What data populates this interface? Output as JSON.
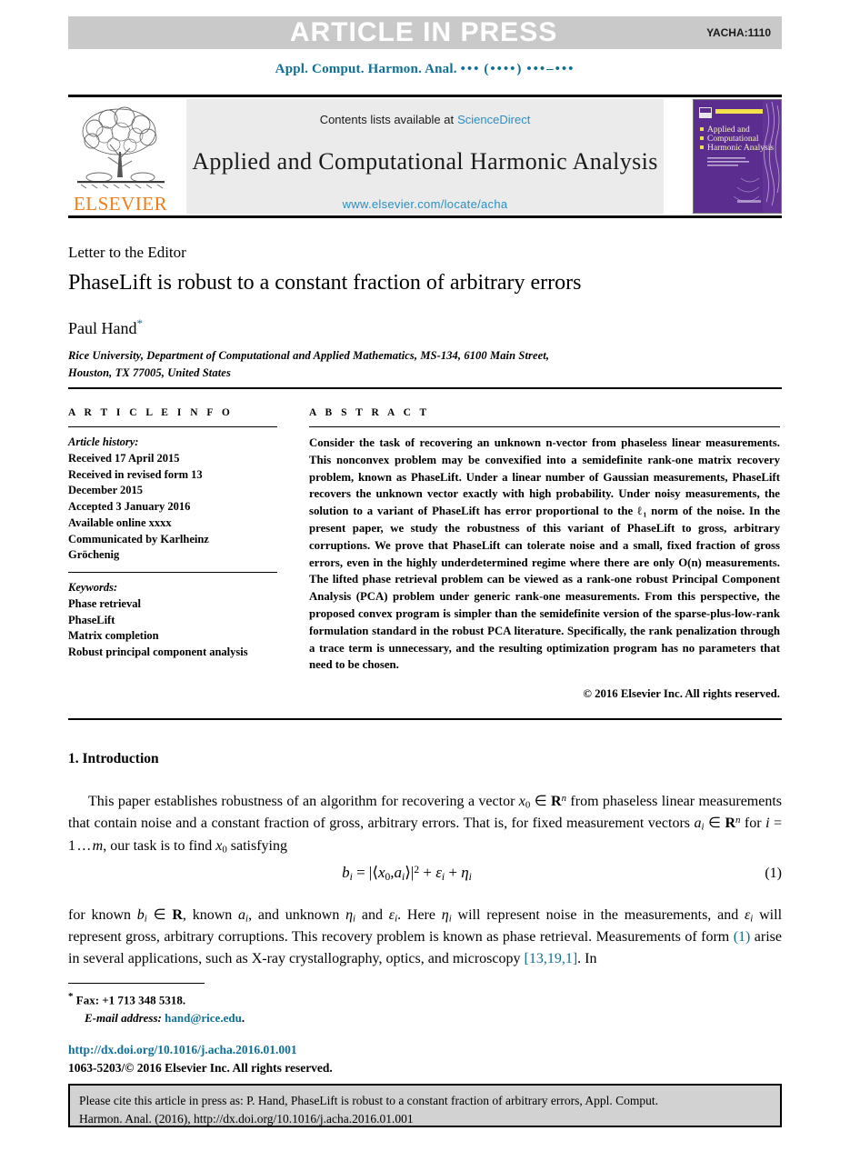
{
  "banner": {
    "title": "ARTICLE IN PRESS",
    "code": "YACHA:1110",
    "bg_color": "#c9c9c9"
  },
  "running_citation": {
    "journal_abbrev": "Appl. Comput. Harmon. Anal.",
    "volume_dots": "•••",
    "year_dots": "(••••)",
    "pages_dots": "•••–•••",
    "color": "#0f6f96"
  },
  "masthead": {
    "publisher": "ELSEVIER",
    "publisher_color": "#f07d1a",
    "contents_text": "Contents lists available at",
    "sciencedirect_link": "ScienceDirect",
    "journal_title": "Applied and Computational Harmonic Analysis",
    "journal_url": "www.elsevier.com/locate/acha",
    "link_color": "#2a8fc4",
    "cover": {
      "line1": "Applied and",
      "line2": "Computational",
      "line3": "Harmonic Analysis",
      "bg_color": "#5b2d8e",
      "accent_color": "#f2e04b"
    }
  },
  "article": {
    "kind": "Letter to the Editor",
    "title": "PhaseLift is robust to a constant fraction of arbitrary errors",
    "author": "Paul Hand",
    "author_footnote_marker": "*",
    "affiliation_line1": "Rice University, Department of Computational and Applied Mathematics, MS-134, 6100 Main Street,",
    "affiliation_line2": "Houston, TX 77005, United States"
  },
  "info": {
    "heading": "A R T I C L E    I N F O",
    "history_label": "Article history:",
    "history_lines": [
      "Received 17 April 2015",
      "Received in revised form 13",
      "December 2015",
      "Accepted 3 January 2016",
      "Available online xxxx",
      "Communicated by Karlheinz",
      "Gröchenig"
    ],
    "keywords_label": "Keywords:",
    "keywords": [
      "Phase retrieval",
      "PhaseLift",
      "Matrix completion",
      "Robust principal component analysis"
    ]
  },
  "abstract": {
    "heading": "A B S T R A C T",
    "body": "Consider the task of recovering an unknown n-vector from phaseless linear measurements. This nonconvex problem may be convexified into a semidefinite rank-one matrix recovery problem, known as PhaseLift. Under a linear number of Gaussian measurements, PhaseLift recovers the unknown vector exactly with high probability. Under noisy measurements, the solution to a variant of PhaseLift has error proportional to the ℓ₁ norm of the noise. In the present paper, we study the robustness of this variant of PhaseLift to gross, arbitrary corruptions. We prove that PhaseLift can tolerate noise and a small, fixed fraction of gross errors, even in the highly underdetermined regime where there are only O(n) measurements. The lifted phase retrieval problem can be viewed as a rank-one robust Principal Component Analysis (PCA) problem under generic rank-one measurements. From this perspective, the proposed convex program is simpler than the semidefinite version of the sparse-plus-low-rank formulation standard in the robust PCA literature. Specifically, the rank penalization through a trace term is unnecessary, and the resulting optimization program has no parameters that need to be chosen.",
    "copyright": "© 2016 Elsevier Inc. All rights reserved."
  },
  "introduction": {
    "heading": "1. Introduction",
    "paragraph1_a": "This paper establishes robustness of an algorithm for recovering a vector ",
    "paragraph1_b": " from phaseless linear measurements that contain noise and a constant fraction of gross, arbitrary errors. That is, for fixed measurement vectors ",
    "paragraph1_c": " satisfying",
    "equation_number": "(1)",
    "paragraph2_text": "for known bᵢ ∈ R, known aᵢ, and unknown ηᵢ and εᵢ. Here ηᵢ will represent noise in the measurements, and εᵢ will represent gross, arbitrary corruptions. This recovery problem is known as phase retrieval. Measurements of form (1) arise in several applications, such as X-ray crystallography, optics, and microscopy [13,19,1]. In",
    "ref_eq_link": "(1)",
    "ref_bib_link": "[13,19,1]"
  },
  "footnotes": {
    "fax_marker": "*",
    "fax_text": "Fax: +1 713 348 5318.",
    "email_label": "E-mail address:",
    "email_value": "hand@rice.edu",
    "doi_url": "http://dx.doi.org/10.1016/j.acha.2016.01.001",
    "issn_line": "1063-5203/© 2016 Elsevier Inc. All rights reserved."
  },
  "cite_box": {
    "line1": "Please cite this article in press as: P. Hand, PhaseLift is robust to a constant fraction of arbitrary errors, Appl. Comput.",
    "line2": "Harmon. Anal. (2016), http://dx.doi.org/10.1016/j.acha.2016.01.001"
  }
}
